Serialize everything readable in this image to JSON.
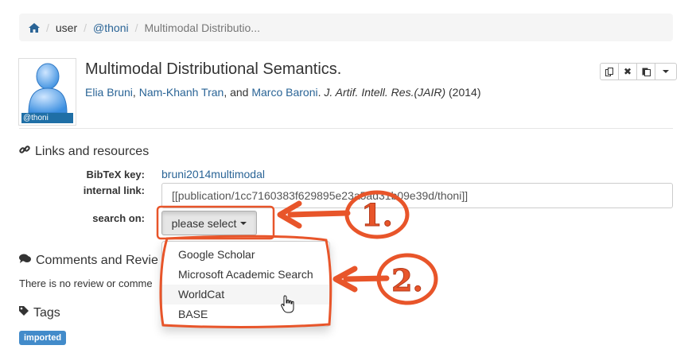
{
  "breadcrumb": {
    "items": [
      "user",
      "@thoni"
    ],
    "current": "Multimodal Distributio..."
  },
  "avatar": {
    "label": "@thoni"
  },
  "publication": {
    "title": "Multimodal Distributional Semantics.",
    "authors": [
      "Elia Bruni",
      "Nam-Khanh Tran",
      "Marco Baroni"
    ],
    "author_sep": ", ",
    "author_and": ", and ",
    "venue": "J. Artif. Intell. Res.(JAIR)",
    "year": "(2014)"
  },
  "links": {
    "heading": "Links and resources",
    "bibtex_label": "BibTeX key:",
    "bibtex_value": "bruni2014multimodal",
    "internal_label": "internal link:",
    "internal_value": "[[publication/1cc7160383f629895e23a5ad31b09e39d/thoni]]",
    "search_label": "search on:",
    "select_label": "please select"
  },
  "dropdown": {
    "options": [
      "Google Scholar",
      "Microsoft Academic Search",
      "WorldCat",
      "BASE"
    ],
    "hovered_index": 2
  },
  "comments": {
    "heading": "Comments and Revie",
    "empty_text": "There is no review or comme"
  },
  "tags": {
    "heading": "Tags",
    "items": [
      "imported"
    ]
  },
  "annotations": {
    "step1": "1.",
    "step2": "2."
  },
  "colors": {
    "annotation": "#e8552a",
    "link": "#2a6496",
    "badge": "#428bca"
  }
}
